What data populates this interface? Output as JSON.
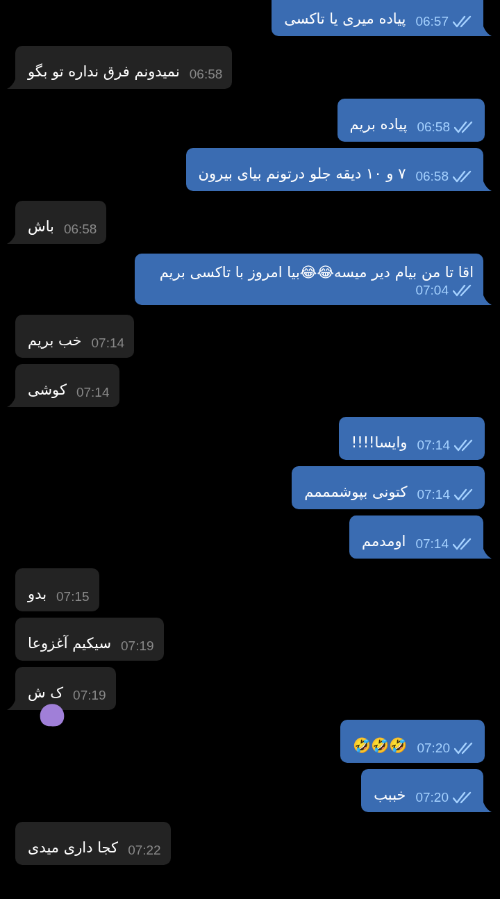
{
  "messages": [
    {
      "kind": "sent",
      "text": "پیاده میری یا تاکسی",
      "time": "06:57",
      "read": true,
      "tail": true
    },
    {
      "kind": "received",
      "text": "نمیدونم فرق نداره تو بگو",
      "time": "06:58",
      "tail": true
    },
    {
      "kind": "sent",
      "text": "پیاده بریم",
      "time": "06:58",
      "read": true,
      "tail": false
    },
    {
      "kind": "sent",
      "text": "۷ و ۱۰ دیقه جلو درتونم بیای بیرون",
      "time": "06:58",
      "read": true,
      "tail": true
    },
    {
      "kind": "received",
      "text": "باش",
      "time": "06:58",
      "tail": true
    },
    {
      "kind": "sent",
      "text": "اقا تا من بیام دیر میسه😂😂بیا امروز با تاکسی بریم",
      "time": "07:04",
      "read": true,
      "tail": true
    },
    {
      "kind": "received",
      "text": "خب بریم",
      "time": "07:14",
      "tail": false
    },
    {
      "kind": "received",
      "text": "کوشی",
      "time": "07:14",
      "tail": true
    },
    {
      "kind": "sent",
      "text": "وایسا!!!!",
      "time": "07:14",
      "read": true,
      "tail": false
    },
    {
      "kind": "sent",
      "text": "کتونی بپوشمممم",
      "time": "07:14",
      "read": true,
      "tail": false
    },
    {
      "kind": "sent",
      "text": "اومدمم",
      "time": "07:14",
      "read": true,
      "tail": true
    },
    {
      "kind": "received",
      "text": "بدو",
      "time": "07:15",
      "tail": false
    },
    {
      "kind": "received",
      "text": "سیکیم آغزوعا",
      "time": "07:19",
      "tail": false
    },
    {
      "kind": "received",
      "text": "ک ش",
      "time": "07:19",
      "tail": true,
      "covered": true
    },
    {
      "kind": "sent",
      "text": "🤣🤣🤣",
      "time": "07:20",
      "read": true,
      "tail": false
    },
    {
      "kind": "sent",
      "text": "خببب",
      "time": "07:20",
      "read": true,
      "tail": true
    },
    {
      "kind": "received",
      "text": "کجا داری میدی",
      "time": "07:22",
      "tail": false
    }
  ]
}
